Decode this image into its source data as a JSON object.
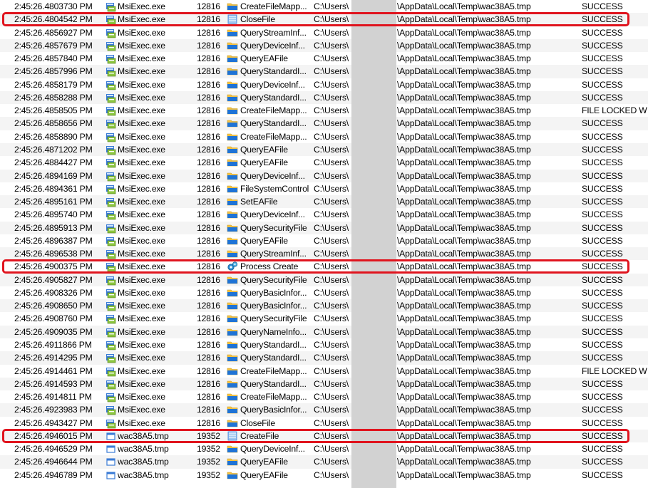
{
  "columns": [
    "Time of Day",
    "Process Name",
    "PID",
    "Operation",
    "Path",
    "Result"
  ],
  "path_prefix": "C:\\Users\\",
  "path_suffix": "\\AppData\\Local\\Temp\\wac38A5.tmp",
  "colors": {
    "highlight_border": "#e0141e",
    "redaction": "#d2d2d2",
    "alt_row": "#f4f4f4"
  },
  "rows": [
    {
      "time": "2:45:26.4803730 PM",
      "process": "MsiExec.exe",
      "pid": "12816",
      "operation": "CreateFileMapp...",
      "path_prefix": "C:\\Users\\",
      "path_suffix": "\\AppData\\Local\\Temp\\wac38A5.tmp",
      "result": "SUCCESS",
      "proc_icon": "msiexec-icon",
      "op_icon": "folder-icon"
    },
    {
      "time": "2:45:26.4804542 PM",
      "process": "MsiExec.exe",
      "pid": "12816",
      "operation": "CloseFile",
      "path_prefix": "C:\\Users\\",
      "path_suffix": "\\AppData\\Local\\Temp\\wac38A5.tmp",
      "result": "SUCCESS",
      "proc_icon": "msiexec-icon",
      "op_icon": "file-op-icon",
      "highlighted": true
    },
    {
      "time": "2:45:26.4856927 PM",
      "process": "MsiExec.exe",
      "pid": "12816",
      "operation": "QueryStreamInf...",
      "path_prefix": "C:\\Users\\",
      "path_suffix": "\\AppData\\Local\\Temp\\wac38A5.tmp",
      "result": "SUCCESS",
      "proc_icon": "msiexec-icon",
      "op_icon": "folder-icon"
    },
    {
      "time": "2:45:26.4857679 PM",
      "process": "MsiExec.exe",
      "pid": "12816",
      "operation": "QueryDeviceInf...",
      "path_prefix": "C:\\Users\\",
      "path_suffix": "\\AppData\\Local\\Temp\\wac38A5.tmp",
      "result": "SUCCESS",
      "proc_icon": "msiexec-icon",
      "op_icon": "folder-icon"
    },
    {
      "time": "2:45:26.4857840 PM",
      "process": "MsiExec.exe",
      "pid": "12816",
      "operation": "QueryEAFile",
      "path_prefix": "C:\\Users\\",
      "path_suffix": "\\AppData\\Local\\Temp\\wac38A5.tmp",
      "result": "SUCCESS",
      "proc_icon": "msiexec-icon",
      "op_icon": "folder-icon"
    },
    {
      "time": "2:45:26.4857996 PM",
      "process": "MsiExec.exe",
      "pid": "12816",
      "operation": "QueryStandardI...",
      "path_prefix": "C:\\Users\\",
      "path_suffix": "\\AppData\\Local\\Temp\\wac38A5.tmp",
      "result": "SUCCESS",
      "proc_icon": "msiexec-icon",
      "op_icon": "folder-icon"
    },
    {
      "time": "2:45:26.4858179 PM",
      "process": "MsiExec.exe",
      "pid": "12816",
      "operation": "QueryDeviceInf...",
      "path_prefix": "C:\\Users\\",
      "path_suffix": "\\AppData\\Local\\Temp\\wac38A5.tmp",
      "result": "SUCCESS",
      "proc_icon": "msiexec-icon",
      "op_icon": "folder-icon"
    },
    {
      "time": "2:45:26.4858288 PM",
      "process": "MsiExec.exe",
      "pid": "12816",
      "operation": "QueryStandardI...",
      "path_prefix": "C:\\Users\\",
      "path_suffix": "\\AppData\\Local\\Temp\\wac38A5.tmp",
      "result": "SUCCESS",
      "proc_icon": "msiexec-icon",
      "op_icon": "folder-icon"
    },
    {
      "time": "2:45:26.4858505 PM",
      "process": "MsiExec.exe",
      "pid": "12816",
      "operation": "CreateFileMapp...",
      "path_prefix": "C:\\Users\\",
      "path_suffix": "\\AppData\\Local\\Temp\\wac38A5.tmp",
      "result": "FILE LOCKED W",
      "proc_icon": "msiexec-icon",
      "op_icon": "folder-icon"
    },
    {
      "time": "2:45:26.4858656 PM",
      "process": "MsiExec.exe",
      "pid": "12816",
      "operation": "QueryStandardI...",
      "path_prefix": "C:\\Users\\",
      "path_suffix": "\\AppData\\Local\\Temp\\wac38A5.tmp",
      "result": "SUCCESS",
      "proc_icon": "msiexec-icon",
      "op_icon": "folder-icon"
    },
    {
      "time": "2:45:26.4858890 PM",
      "process": "MsiExec.exe",
      "pid": "12816",
      "operation": "CreateFileMapp...",
      "path_prefix": "C:\\Users\\",
      "path_suffix": "\\AppData\\Local\\Temp\\wac38A5.tmp",
      "result": "SUCCESS",
      "proc_icon": "msiexec-icon",
      "op_icon": "folder-icon"
    },
    {
      "time": "2:45:26.4871202 PM",
      "process": "MsiExec.exe",
      "pid": "12816",
      "operation": "QueryEAFile",
      "path_prefix": "C:\\Users\\",
      "path_suffix": "\\AppData\\Local\\Temp\\wac38A5.tmp",
      "result": "SUCCESS",
      "proc_icon": "msiexec-icon",
      "op_icon": "folder-icon"
    },
    {
      "time": "2:45:26.4884427 PM",
      "process": "MsiExec.exe",
      "pid": "12816",
      "operation": "QueryEAFile",
      "path_prefix": "C:\\Users\\",
      "path_suffix": "\\AppData\\Local\\Temp\\wac38A5.tmp",
      "result": "SUCCESS",
      "proc_icon": "msiexec-icon",
      "op_icon": "folder-icon"
    },
    {
      "time": "2:45:26.4894169 PM",
      "process": "MsiExec.exe",
      "pid": "12816",
      "operation": "QueryDeviceInf...",
      "path_prefix": "C:\\Users\\",
      "path_suffix": "\\AppData\\Local\\Temp\\wac38A5.tmp",
      "result": "SUCCESS",
      "proc_icon": "msiexec-icon",
      "op_icon": "folder-icon"
    },
    {
      "time": "2:45:26.4894361 PM",
      "process": "MsiExec.exe",
      "pid": "12816",
      "operation": "FileSystemControl",
      "path_prefix": "C:\\Users\\",
      "path_suffix": "\\AppData\\Local\\Temp\\wac38A5.tmp",
      "result": "SUCCESS",
      "proc_icon": "msiexec-icon",
      "op_icon": "folder-icon"
    },
    {
      "time": "2:45:26.4895161 PM",
      "process": "MsiExec.exe",
      "pid": "12816",
      "operation": "SetEAFile",
      "path_prefix": "C:\\Users\\",
      "path_suffix": "\\AppData\\Local\\Temp\\wac38A5.tmp",
      "result": "SUCCESS",
      "proc_icon": "msiexec-icon",
      "op_icon": "folder-icon"
    },
    {
      "time": "2:45:26.4895740 PM",
      "process": "MsiExec.exe",
      "pid": "12816",
      "operation": "QueryDeviceInf...",
      "path_prefix": "C:\\Users\\",
      "path_suffix": "\\AppData\\Local\\Temp\\wac38A5.tmp",
      "result": "SUCCESS",
      "proc_icon": "msiexec-icon",
      "op_icon": "folder-icon"
    },
    {
      "time": "2:45:26.4895913 PM",
      "process": "MsiExec.exe",
      "pid": "12816",
      "operation": "QuerySecurityFile",
      "path_prefix": "C:\\Users\\",
      "path_suffix": "\\AppData\\Local\\Temp\\wac38A5.tmp",
      "result": "SUCCESS",
      "proc_icon": "msiexec-icon",
      "op_icon": "folder-icon"
    },
    {
      "time": "2:45:26.4896387 PM",
      "process": "MsiExec.exe",
      "pid": "12816",
      "operation": "QueryEAFile",
      "path_prefix": "C:\\Users\\",
      "path_suffix": "\\AppData\\Local\\Temp\\wac38A5.tmp",
      "result": "SUCCESS",
      "proc_icon": "msiexec-icon",
      "op_icon": "folder-icon"
    },
    {
      "time": "2:45:26.4896538 PM",
      "process": "MsiExec.exe",
      "pid": "12816",
      "operation": "QueryStreamInf...",
      "path_prefix": "C:\\Users\\",
      "path_suffix": "\\AppData\\Local\\Temp\\wac38A5.tmp",
      "result": "SUCCESS",
      "proc_icon": "msiexec-icon",
      "op_icon": "folder-icon"
    },
    {
      "time": "2:45:26.4900375 PM",
      "process": "MsiExec.exe",
      "pid": "12816",
      "operation": "Process Create",
      "path_prefix": "C:\\Users\\",
      "path_suffix": "\\AppData\\Local\\Temp\\wac38A5.tmp",
      "result": "SUCCESS",
      "proc_icon": "msiexec-icon",
      "op_icon": "process-create-icon",
      "highlighted": true
    },
    {
      "time": "2:45:26.4905827 PM",
      "process": "MsiExec.exe",
      "pid": "12816",
      "operation": "QuerySecurityFile",
      "path_prefix": "C:\\Users\\",
      "path_suffix": "\\AppData\\Local\\Temp\\wac38A5.tmp",
      "result": "SUCCESS",
      "proc_icon": "msiexec-icon",
      "op_icon": "folder-icon"
    },
    {
      "time": "2:45:26.4908326 PM",
      "process": "MsiExec.exe",
      "pid": "12816",
      "operation": "QueryBasicInfor...",
      "path_prefix": "C:\\Users\\",
      "path_suffix": "\\AppData\\Local\\Temp\\wac38A5.tmp",
      "result": "SUCCESS",
      "proc_icon": "msiexec-icon",
      "op_icon": "folder-icon"
    },
    {
      "time": "2:45:26.4908650 PM",
      "process": "MsiExec.exe",
      "pid": "12816",
      "operation": "QueryBasicInfor...",
      "path_prefix": "C:\\Users\\",
      "path_suffix": "\\AppData\\Local\\Temp\\wac38A5.tmp",
      "result": "SUCCESS",
      "proc_icon": "msiexec-icon",
      "op_icon": "folder-icon"
    },
    {
      "time": "2:45:26.4908760 PM",
      "process": "MsiExec.exe",
      "pid": "12816",
      "operation": "QuerySecurityFile",
      "path_prefix": "C:\\Users\\",
      "path_suffix": "\\AppData\\Local\\Temp\\wac38A5.tmp",
      "result": "SUCCESS",
      "proc_icon": "msiexec-icon",
      "op_icon": "folder-icon"
    },
    {
      "time": "2:45:26.4909035 PM",
      "process": "MsiExec.exe",
      "pid": "12816",
      "operation": "QueryNameInfo...",
      "path_prefix": "C:\\Users\\",
      "path_suffix": "\\AppData\\Local\\Temp\\wac38A5.tmp",
      "result": "SUCCESS",
      "proc_icon": "msiexec-icon",
      "op_icon": "folder-icon"
    },
    {
      "time": "2:45:26.4911866 PM",
      "process": "MsiExec.exe",
      "pid": "12816",
      "operation": "QueryStandardI...",
      "path_prefix": "C:\\Users\\",
      "path_suffix": "\\AppData\\Local\\Temp\\wac38A5.tmp",
      "result": "SUCCESS",
      "proc_icon": "msiexec-icon",
      "op_icon": "folder-icon"
    },
    {
      "time": "2:45:26.4914295 PM",
      "process": "MsiExec.exe",
      "pid": "12816",
      "operation": "QueryStandardI...",
      "path_prefix": "C:\\Users\\",
      "path_suffix": "\\AppData\\Local\\Temp\\wac38A5.tmp",
      "result": "SUCCESS",
      "proc_icon": "msiexec-icon",
      "op_icon": "folder-icon"
    },
    {
      "time": "2:45:26.4914461 PM",
      "process": "MsiExec.exe",
      "pid": "12816",
      "operation": "CreateFileMapp...",
      "path_prefix": "C:\\Users\\",
      "path_suffix": "\\AppData\\Local\\Temp\\wac38A5.tmp",
      "result": "FILE LOCKED W",
      "proc_icon": "msiexec-icon",
      "op_icon": "folder-icon"
    },
    {
      "time": "2:45:26.4914593 PM",
      "process": "MsiExec.exe",
      "pid": "12816",
      "operation": "QueryStandardI...",
      "path_prefix": "C:\\Users\\",
      "path_suffix": "\\AppData\\Local\\Temp\\wac38A5.tmp",
      "result": "SUCCESS",
      "proc_icon": "msiexec-icon",
      "op_icon": "folder-icon"
    },
    {
      "time": "2:45:26.4914811 PM",
      "process": "MsiExec.exe",
      "pid": "12816",
      "operation": "CreateFileMapp...",
      "path_prefix": "C:\\Users\\",
      "path_suffix": "\\AppData\\Local\\Temp\\wac38A5.tmp",
      "result": "SUCCESS",
      "proc_icon": "msiexec-icon",
      "op_icon": "folder-icon"
    },
    {
      "time": "2:45:26.4923983 PM",
      "process": "MsiExec.exe",
      "pid": "12816",
      "operation": "QueryBasicInfor...",
      "path_prefix": "C:\\Users\\",
      "path_suffix": "\\AppData\\Local\\Temp\\wac38A5.tmp",
      "result": "SUCCESS",
      "proc_icon": "msiexec-icon",
      "op_icon": "folder-icon"
    },
    {
      "time": "2:45:26.4943427 PM",
      "process": "MsiExec.exe",
      "pid": "12816",
      "operation": "CloseFile",
      "path_prefix": "C:\\Users\\",
      "path_suffix": "\\AppData\\Local\\Temp\\wac38A5.tmp",
      "result": "SUCCESS",
      "proc_icon": "msiexec-icon",
      "op_icon": "folder-icon"
    },
    {
      "time": "2:45:26.4946015 PM",
      "process": "wac38A5.tmp",
      "pid": "19352",
      "operation": "CreateFile",
      "path_prefix": "C:\\Users\\",
      "path_suffix": "\\AppData\\Local\\Temp\\wac38A5.tmp",
      "result": "SUCCESS",
      "proc_icon": "tmp-process-icon",
      "op_icon": "file-op-icon",
      "highlighted": true
    },
    {
      "time": "2:45:26.4946529 PM",
      "process": "wac38A5.tmp",
      "pid": "19352",
      "operation": "QueryDeviceInf...",
      "path_prefix": "C:\\Users\\",
      "path_suffix": "\\AppData\\Local\\Temp\\wac38A5.tmp",
      "result": "SUCCESS",
      "proc_icon": "tmp-process-icon",
      "op_icon": "folder-icon"
    },
    {
      "time": "2:45:26.4946644 PM",
      "process": "wac38A5.tmp",
      "pid": "19352",
      "operation": "QueryEAFile",
      "path_prefix": "C:\\Users\\",
      "path_suffix": "\\AppData\\Local\\Temp\\wac38A5.tmp",
      "result": "SUCCESS",
      "proc_icon": "tmp-process-icon",
      "op_icon": "folder-icon"
    },
    {
      "time": "2:45:26.4946789 PM",
      "process": "wac38A5.tmp",
      "pid": "19352",
      "operation": "QueryEAFile",
      "path_prefix": "C:\\Users\\",
      "path_suffix": "\\AppData\\Local\\Temp\\wac38A5.tmp",
      "result": "SUCCESS",
      "proc_icon": "tmp-process-icon",
      "op_icon": "folder-icon"
    }
  ]
}
